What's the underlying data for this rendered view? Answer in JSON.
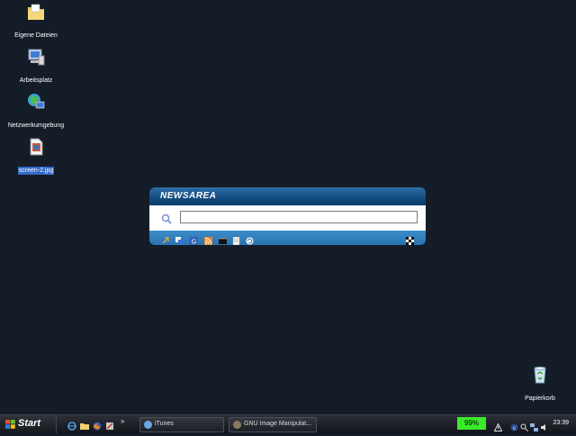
{
  "desktop": {
    "icons": [
      {
        "label": "Eigene Dateien",
        "icon": "folder-icon"
      },
      {
        "label": "Arbeitsplatz",
        "icon": "computer-icon"
      },
      {
        "label": "Netzwerkumgebung",
        "icon": "network-icon"
      },
      {
        "label": "screen-2.jpg",
        "icon": "image-file-icon"
      }
    ],
    "recycle_bin": {
      "label": "Papierkorb",
      "icon": "recycle-bin-icon"
    }
  },
  "widget": {
    "title": "NEWSAREA",
    "search": {
      "value": "",
      "placeholder": ""
    },
    "toolbar_icons": [
      "arrow-icon",
      "translate-icon",
      "google-icon",
      "rss-icon",
      "terminal-icon",
      "document-icon",
      "refresh-icon",
      "chess-icon"
    ]
  },
  "taskbar": {
    "start_label": "Start",
    "quick_launch": [
      "ie-icon",
      "folder-icon",
      "firefox-icon",
      "tools-icon"
    ],
    "tasks": [
      {
        "label": "iTunes",
        "icon": "itunes-icon"
      },
      {
        "label": "GNU Image Manipulat...",
        "icon": "gimp-icon"
      }
    ],
    "battery": "99%",
    "clock": "23:39"
  }
}
